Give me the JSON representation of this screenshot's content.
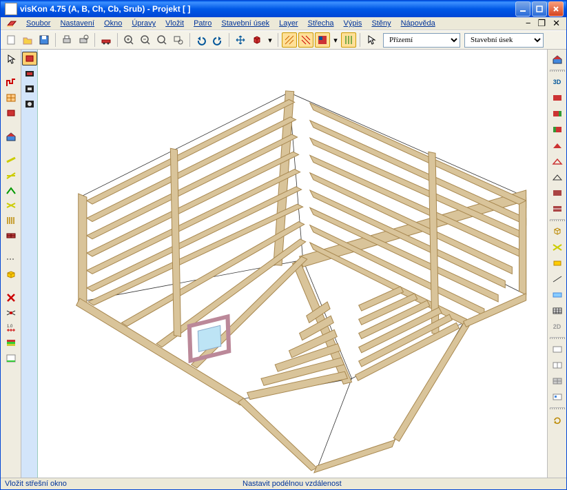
{
  "title": "visKon 4.75 (A, B, Ch, Cb, Srub) - Projekt [  ]",
  "menus": [
    "Soubor",
    "Nastavení",
    "Okno",
    "Úpravy",
    "Vložit",
    "Patro",
    "Stavební úsek",
    "Layer",
    "Střecha",
    "Výpis",
    "Stěny",
    "Nápověda"
  ],
  "toolbar": {
    "floor_selected": "Přízemí",
    "section_selected": "Stavební úsek"
  },
  "status": {
    "left": "Vložit střešní okno",
    "right": "Nastavit podélnou vzdálenost"
  },
  "left_palette": {
    "selected_index": 0
  },
  "right_labels": {
    "view3d": "3D",
    "view2d": "2D"
  }
}
